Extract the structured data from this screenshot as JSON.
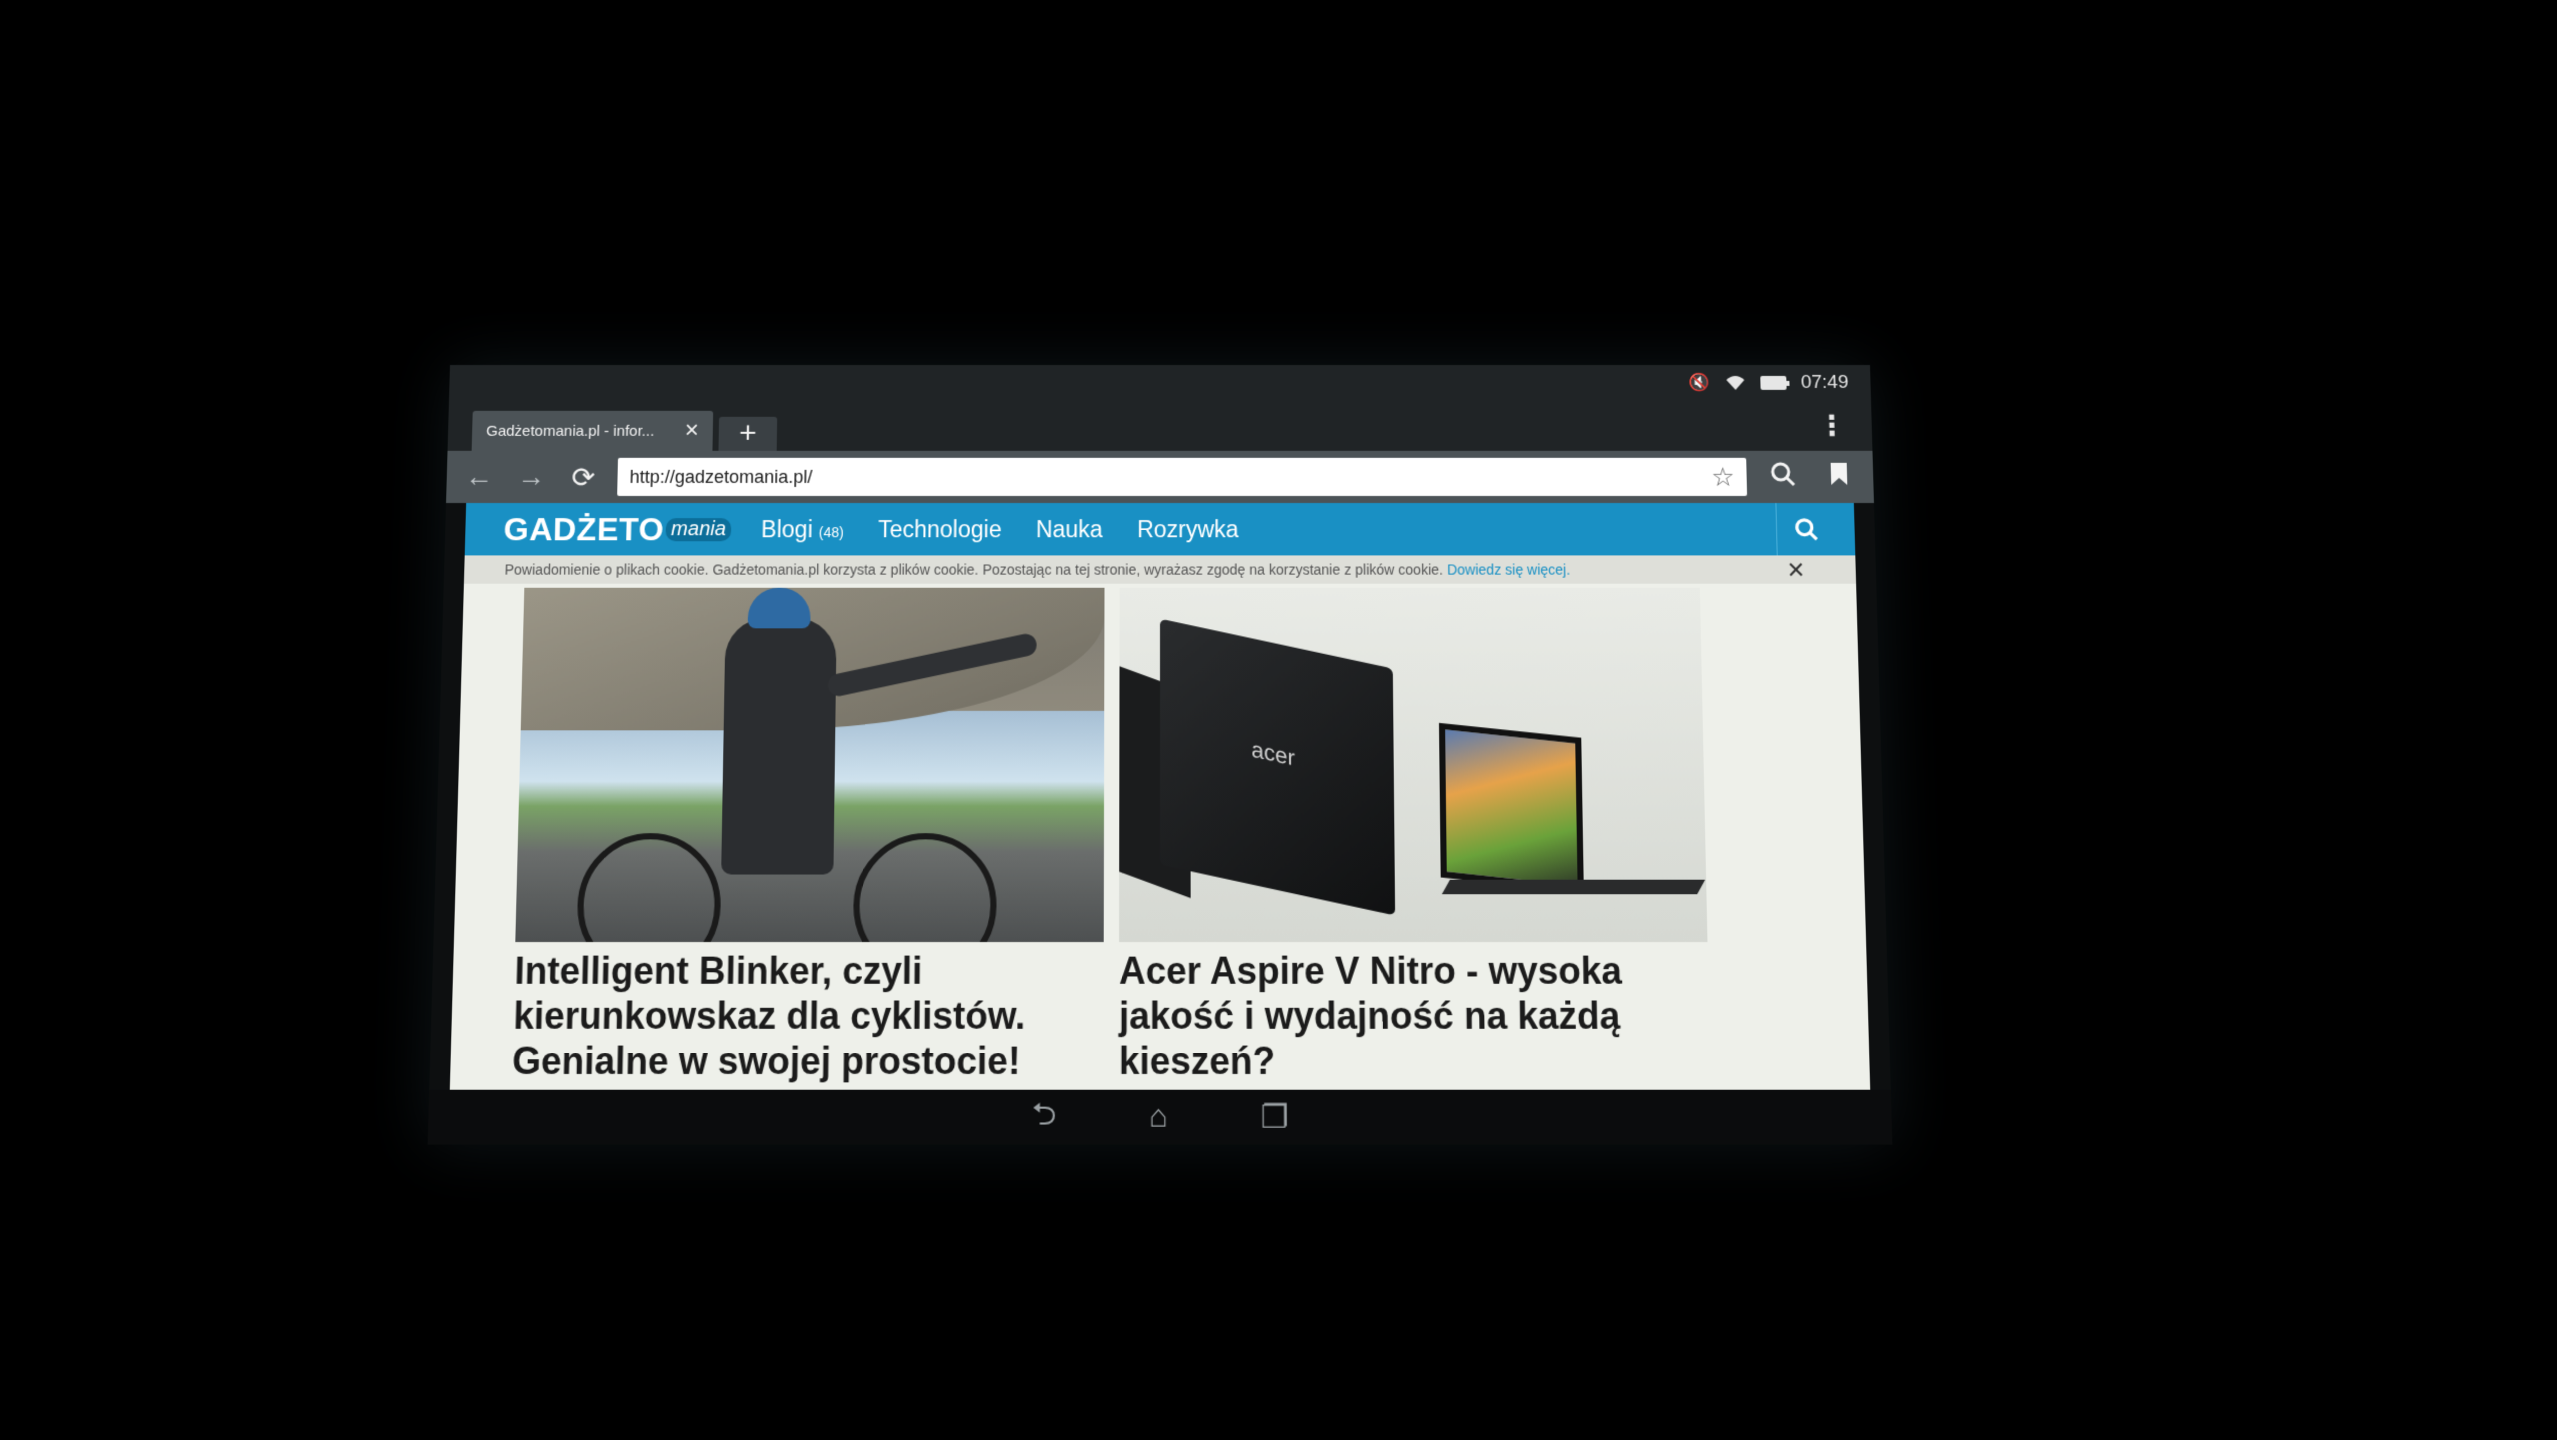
{
  "status_bar": {
    "time": "07:49",
    "icons": [
      "mute-icon",
      "wifi-icon",
      "battery-icon"
    ]
  },
  "tabs": [
    {
      "label": "Gadżetomania.pl - infor...",
      "active": true
    }
  ],
  "toolbar": {
    "url": "http://gadzetomania.pl/"
  },
  "site": {
    "logo_main": "GADŻETO",
    "logo_sub": "mania",
    "nav": [
      {
        "label": "Blogi",
        "badge": "(48)"
      },
      {
        "label": "Technologie"
      },
      {
        "label": "Nauka"
      },
      {
        "label": "Rozrywka"
      }
    ],
    "brand_color": "#1990c4"
  },
  "cookie_bar": {
    "text": "Powiadomienie o plikach cookie. Gadżetomania.pl korzysta z plików cookie. Pozostając na tej stronie, wyrażasz zgodę na korzystanie z plików cookie.",
    "link": "Dowiedz się więcej."
  },
  "articles": [
    {
      "title": "Intelligent Blinker, czyli kierunkowskaz dla cyklistów. Genialne w swojej prostocie!"
    },
    {
      "title": "Acer Aspire V Nitro - wysoka jakość i wydajność na każdą kieszeń?",
      "image_brand": "acer"
    }
  ]
}
